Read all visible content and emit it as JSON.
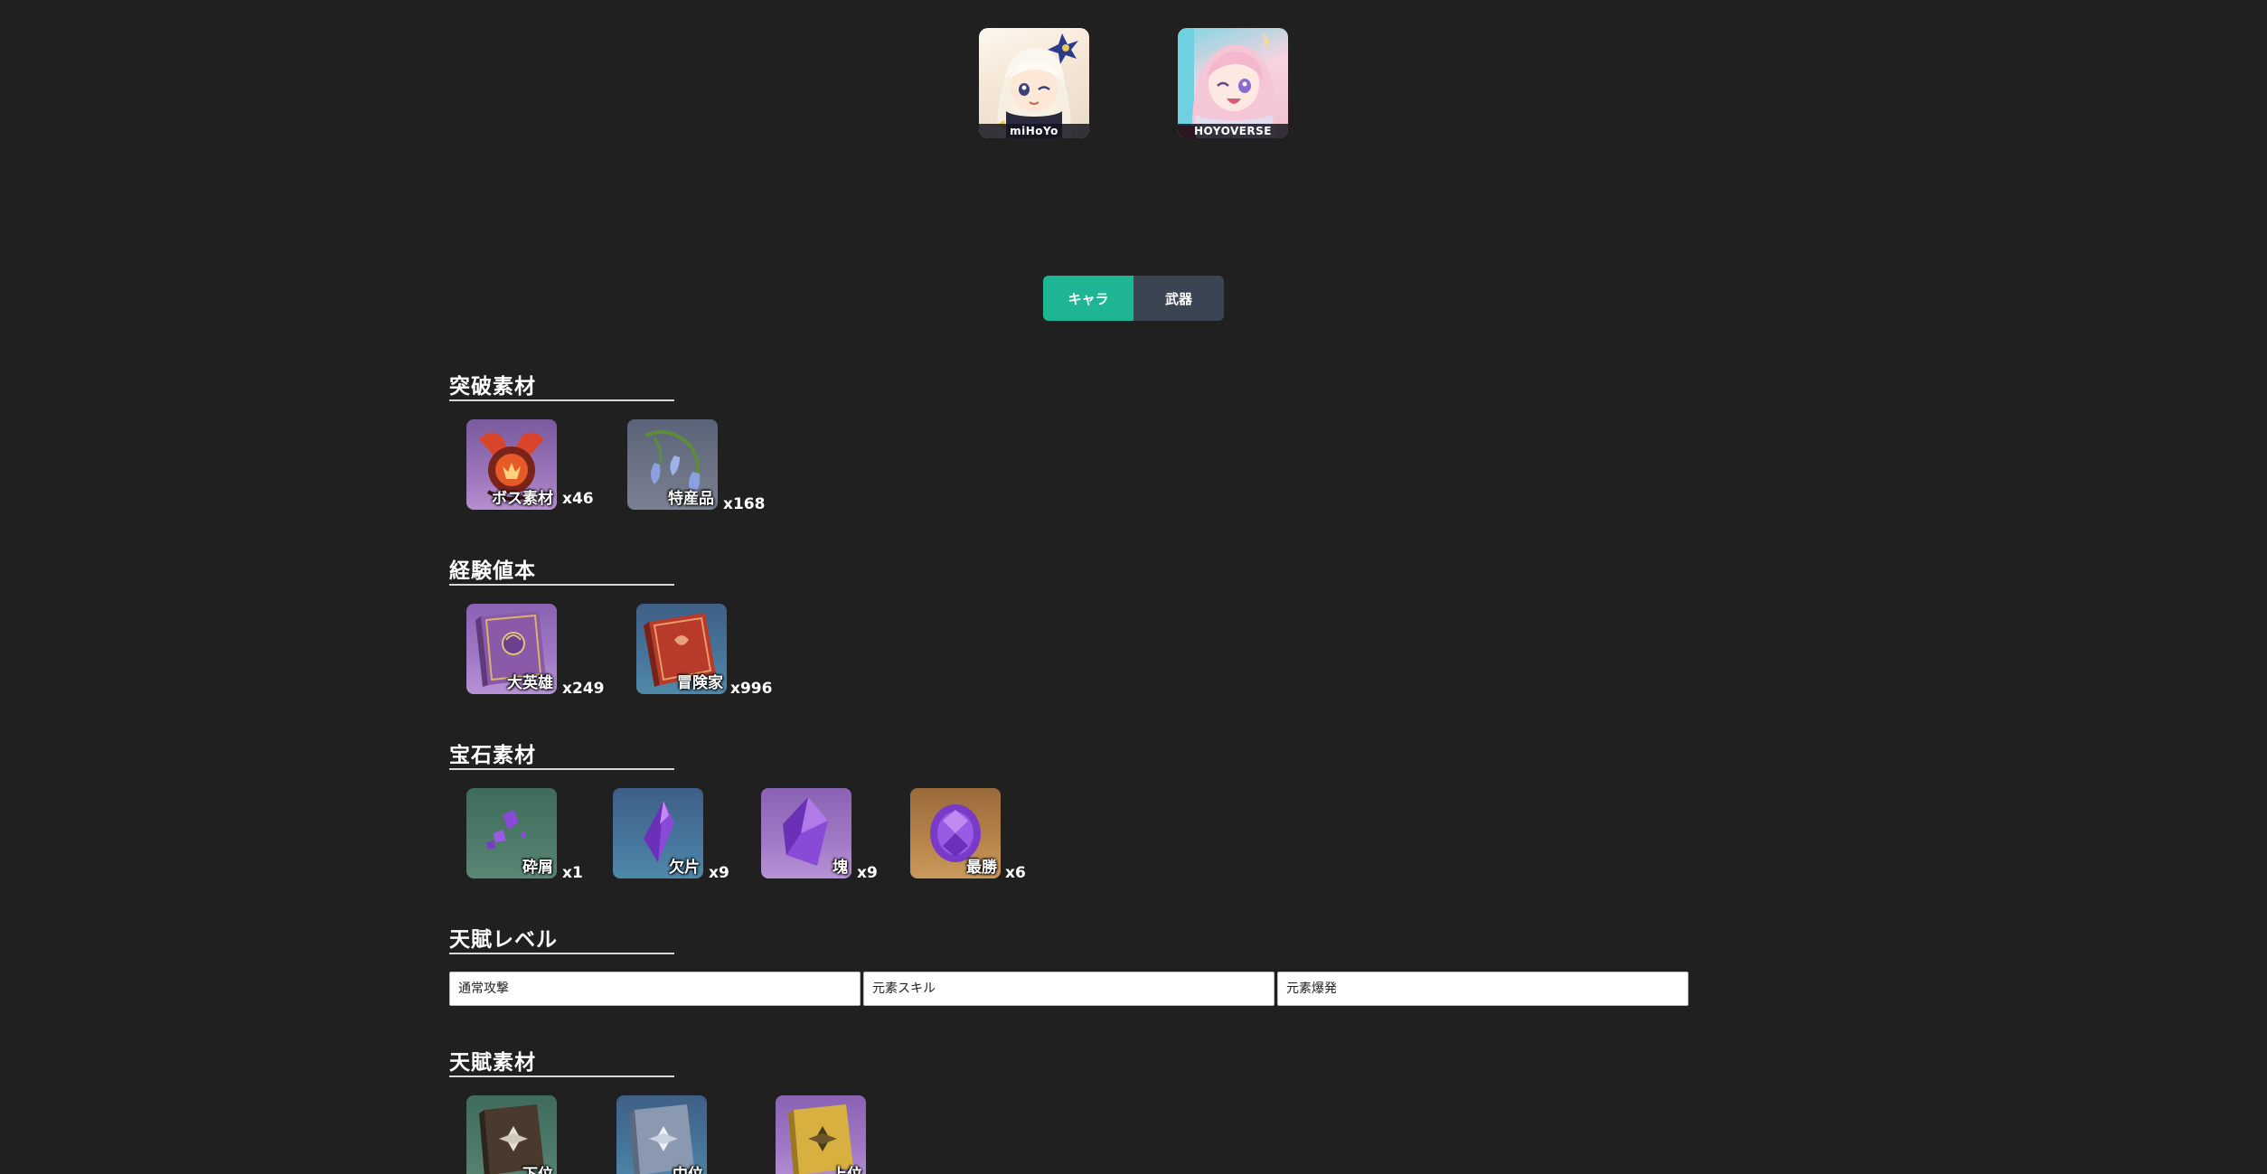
{
  "games": [
    {
      "caption": "miHoYo",
      "icon": "paimon-avatar-icon"
    },
    {
      "caption": "HOYOVERSE",
      "icon": "march-7th-avatar-icon"
    }
  ],
  "toggle": {
    "active_label": "キャラ",
    "inactive_label": "武器",
    "active_color": "#1db593",
    "inactive_color": "#3a4453"
  },
  "sections": {
    "ascension": {
      "title": "突破素材",
      "items": [
        {
          "label": "ボス素材",
          "qty": "x46",
          "icon": "boss-material-icon"
        },
        {
          "label": "特産品",
          "qty": "x168",
          "icon": "local-specialty-icon"
        }
      ]
    },
    "exp": {
      "title": "経験値本",
      "items": [
        {
          "label": "大英雄",
          "qty": "x249",
          "icon": "heros-wit-book-icon"
        },
        {
          "label": "冒険家",
          "qty": "x996",
          "icon": "adventurers-experience-book-icon"
        }
      ]
    },
    "gems": {
      "title": "宝石素材",
      "items": [
        {
          "label": "砕屑",
          "qty": "x1",
          "icon": "gem-sliver-icon"
        },
        {
          "label": "欠片",
          "qty": "x9",
          "icon": "gem-fragment-icon"
        },
        {
          "label": "塊",
          "qty": "x9",
          "icon": "gem-chunk-icon"
        },
        {
          "label": "最勝",
          "qty": "x6",
          "icon": "gem-gemstone-icon"
        }
      ]
    },
    "talent_level": {
      "title": "天賦レベル",
      "inputs": [
        {
          "placeholder": "通常攻撃"
        },
        {
          "placeholder": "元素スキル"
        },
        {
          "placeholder": "元素爆発"
        }
      ]
    },
    "talent_materials": {
      "title": "天賦素材",
      "items": [
        {
          "label": "下位",
          "icon": "talent-book-teachings-icon"
        },
        {
          "label": "中位",
          "icon": "talent-book-guide-icon"
        },
        {
          "label": "上位",
          "icon": "talent-book-philosophies-icon"
        }
      ]
    }
  }
}
